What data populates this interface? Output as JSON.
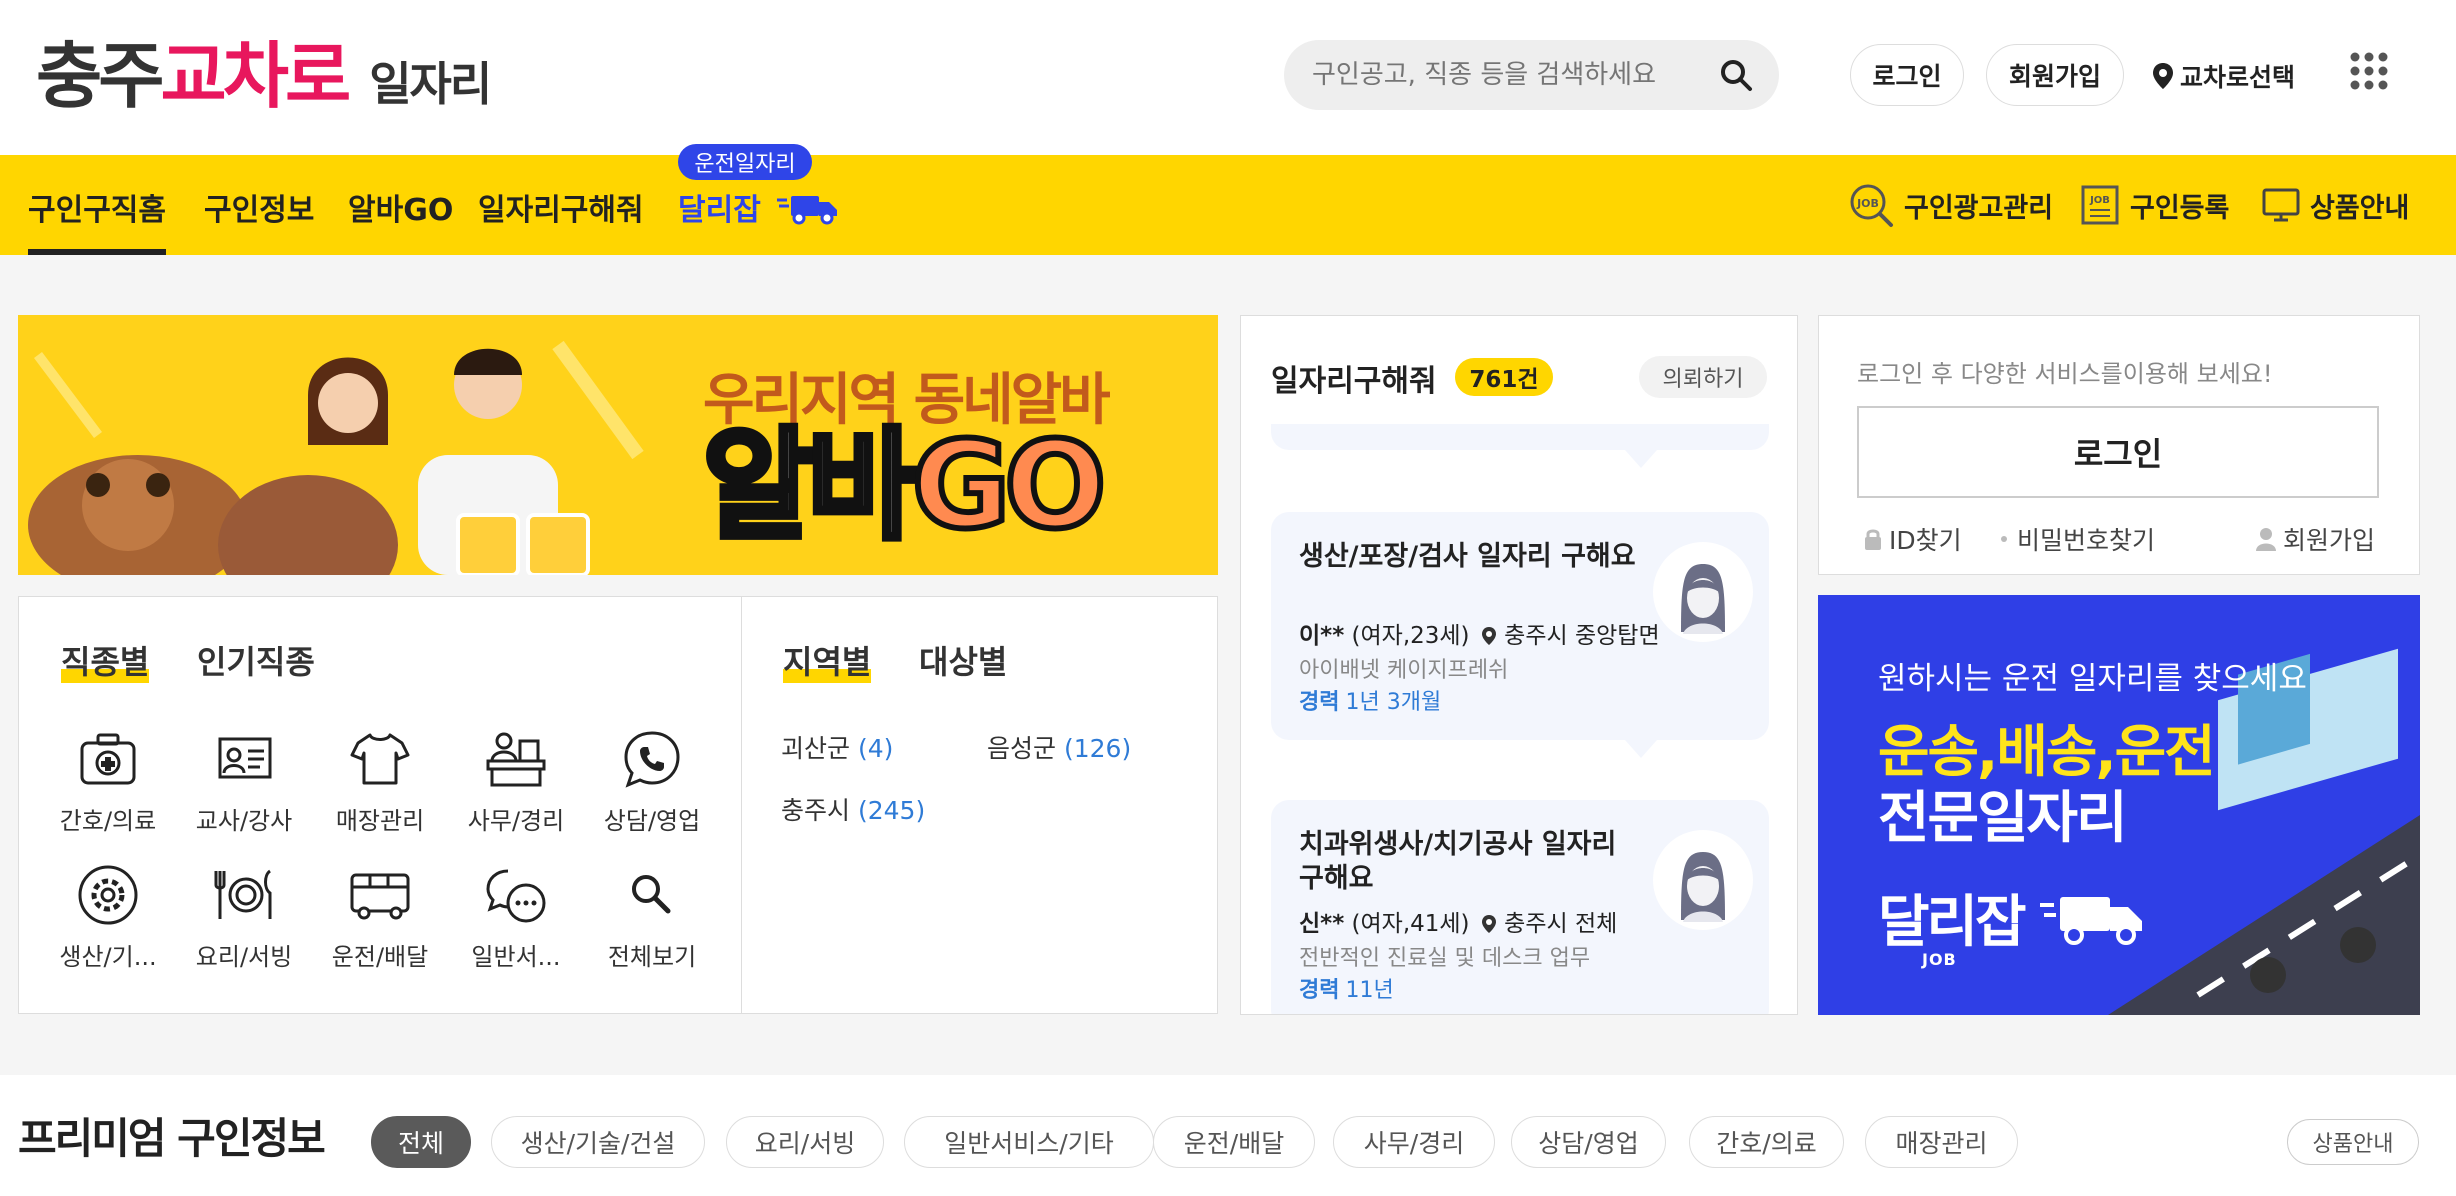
{
  "header": {
    "logo_part1": "충주",
    "logo_part2": "교차로",
    "logo_part3": "일자리",
    "search_placeholder": "구인공고, 직종 등을 검색하세요",
    "login": "로그인",
    "signup": "회원가입",
    "region_select": "교차로선택"
  },
  "nav": {
    "items": [
      "구인구직홈",
      "구인정보",
      "알바GO",
      "일자리구해줘",
      "달리잡"
    ],
    "badge": "운전일자리",
    "right": [
      "구인광고관리",
      "구인등록",
      "상품안내"
    ]
  },
  "banner": {
    "line1": "우리지역 동네알바",
    "line2a": "알바",
    "line2b": "GO"
  },
  "categories": {
    "tab_job": "직종별",
    "tab_popular": "인기직종",
    "items": [
      "간호/의료",
      "교사/강사",
      "매장관리",
      "사무/경리",
      "상담/영업",
      "생산/기...",
      "요리/서빙",
      "운전/배달",
      "일반서...",
      "전체보기"
    ],
    "tab_region": "지역별",
    "tab_target": "대상별",
    "regions": [
      {
        "name": "괴산군",
        "count": "(4)"
      },
      {
        "name": "음성군",
        "count": "(126)"
      },
      {
        "name": "충주시",
        "count": "(245)"
      }
    ]
  },
  "job_request": {
    "title": "일자리구해줘",
    "count": "761건",
    "request": "의뢰하기",
    "cards": [
      {
        "title": "생산/포장/검사 일자리 구해요",
        "name": "이**",
        "info": "(여자,23세)",
        "loc": "충주시 중앙탑면",
        "desc": "아이배넷 케이지프레쉬",
        "exp_label": "경력",
        "exp": "1년 3개월"
      },
      {
        "title": "치과위생사/치기공사 일자리 구해요",
        "name": "신**",
        "info": "(여자,41세)",
        "loc": "충주시 전체",
        "desc": "전반적인 진료실 및 데스크 업무",
        "exp_label": "경력",
        "exp": "11년"
      }
    ]
  },
  "login_box": {
    "message": "로그인 후 다양한 서비스를이용해 보세요!",
    "button": "로그인",
    "find_id": "ID찾기",
    "find_pw": "비밀번호찾기",
    "signup": "회원가입"
  },
  "ad": {
    "line1": "원하시는 운전 일자리를 찾으세요",
    "line2": "운송,배송,운전",
    "line3": "전문일자리",
    "brand": "달리잡",
    "brand_sub": "JOB"
  },
  "premium": {
    "title": "프리미엄 구인정보",
    "chips": [
      "전체",
      "생산/기술/건설",
      "요리/서빙",
      "일반서비스/기타",
      "운전/배달",
      "사무/경리",
      "상담/영업",
      "간호/의료",
      "매장관리"
    ],
    "product_info": "상품안내"
  },
  "colors": {
    "brand_red": "#e8175d",
    "nav_yellow": "#ffd600",
    "accent_blue": "#2f45e8",
    "count_blue": "#2f7bd6"
  }
}
